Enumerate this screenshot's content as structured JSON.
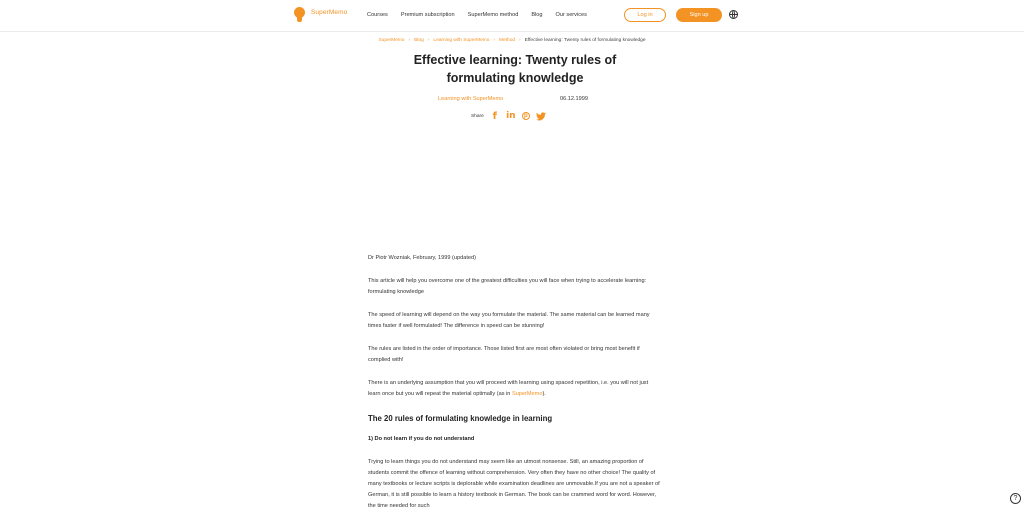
{
  "header": {
    "logo_text": "SuperMemo",
    "nav": [
      "Courses",
      "Premium subscription",
      "SuperMemo method",
      "Blog",
      "Our services"
    ],
    "login_label": "Log in",
    "signup_label": "Sign up"
  },
  "breadcrumb": {
    "items": [
      "SuperMemo",
      "Blog",
      "Learning with SuperMemo",
      "Method"
    ],
    "current": "Effective learning: Twenty rules of formulating knowledge"
  },
  "article": {
    "title": "Effective learning: Twenty rules of formulating knowledge",
    "category": "Learning with SuperMemo",
    "date": "06.12.1999",
    "share_label": "Share",
    "byline": "Dr Piotr Wozniak, February, 1999 (updated)",
    "paragraphs": [
      "This article will help you overcome one of the greatest difficulties you will face when trying to accelerate learning: formulating knowledge",
      "The speed of learning will depend on the way you formulate the material. The same material can be learned many times faster if well formulated! The difference in speed can be stunning!",
      "The rules are listed in the order of importance. Those listed first are most often violated or bring most benefit if complied with!"
    ],
    "assumption_text": "There is an underlying assumption that you will proceed with learning using spaced repetition, i.e. you will not just learn once but you will repeat the material optimally (as in",
    "assumption_link": "SuperMemo",
    "assumption_end": ").",
    "section_heading": "The 20 rules of formulating knowledge in learning",
    "rule_heading": "1) Do not learn if you do not understand",
    "rule_text": "Trying to learn things you do not understand may seem like an utmost nonsense. Still, an amazing proportion of students commit the offence of learning without comprehension. Very often they have no other choice! The quality of many textbooks or lecture scripts is deplorable while examination deadlines are unmovable.If you are not a speaker of German, it is still possible to learn a history textbook in German. The book can be crammed word for word. However, the time needed for such"
  },
  "colors": {
    "accent": "#f39324"
  },
  "icons": [
    "supermemo-logo-icon",
    "globe-icon",
    "facebook-icon",
    "linkedin-icon",
    "pinterest-icon",
    "twitter-icon",
    "help-icon"
  ]
}
